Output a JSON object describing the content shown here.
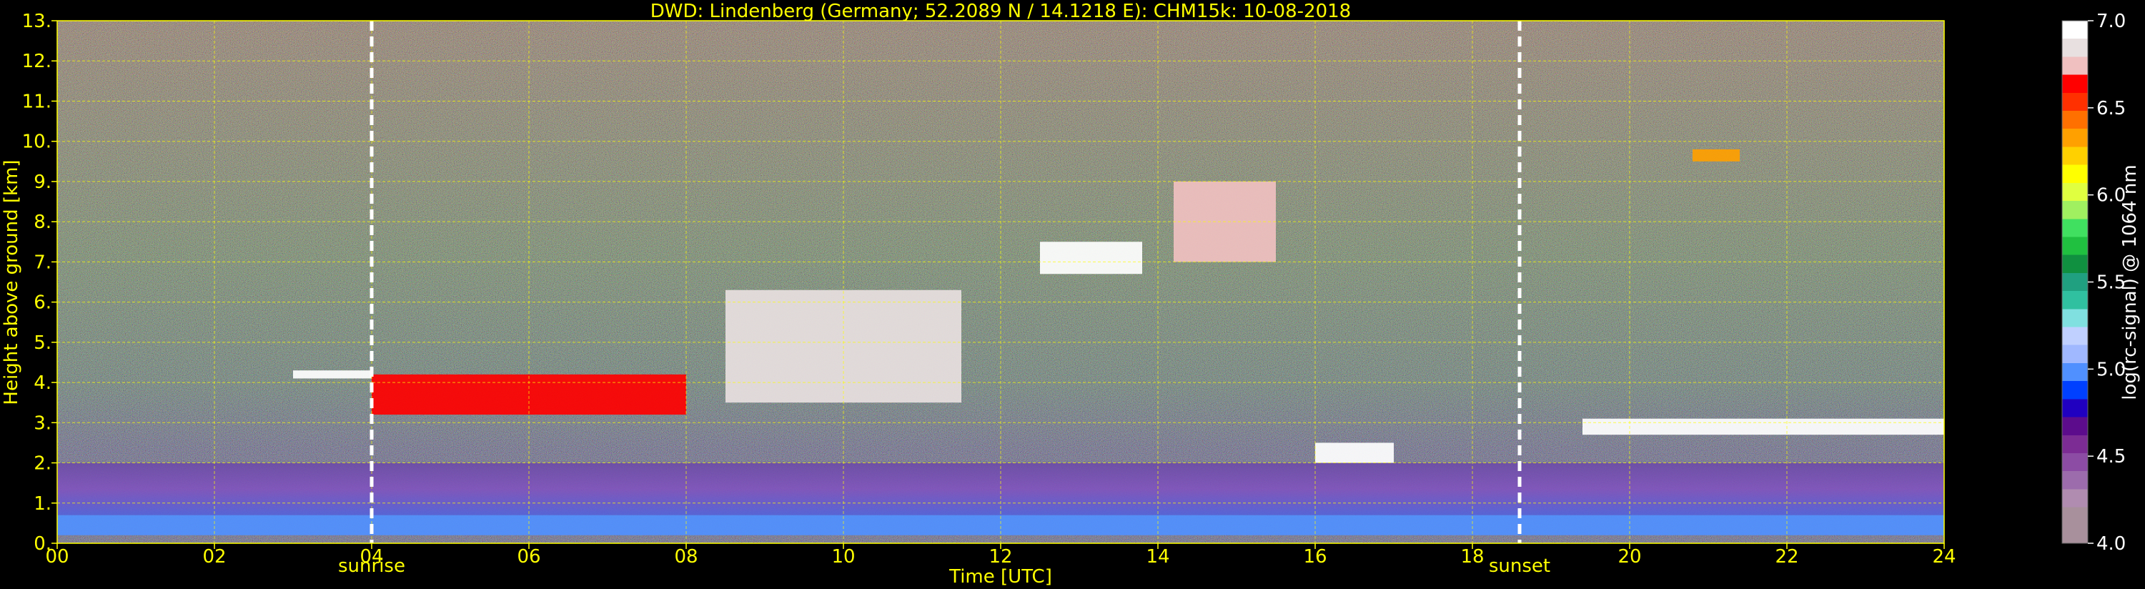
{
  "chart_data": {
    "type": "heatmap",
    "title": "DWD: Lindenberg (Germany; 52.2089 N / 14.1218 E):    CHM15k: 10-08-2018",
    "xlabel": "Time [UTC]",
    "ylabel": "Height above ground [km]",
    "xlim": [
      0,
      24
    ],
    "ylim": [
      0,
      13
    ],
    "x_ticks": [
      "00",
      "02",
      "04",
      "06",
      "08",
      "10",
      "12",
      "14",
      "16",
      "18",
      "20",
      "22",
      "24"
    ],
    "x_tick_values": [
      0,
      2,
      4,
      6,
      8,
      10,
      12,
      14,
      16,
      18,
      20,
      22,
      24
    ],
    "y_ticks": [
      "0.",
      "1.",
      "2.",
      "3.",
      "4.",
      "5.",
      "6.",
      "7.",
      "8.",
      "9.",
      "10.",
      "11.",
      "12.",
      "13."
    ],
    "y_tick_values": [
      0,
      1,
      2,
      3,
      4,
      5,
      6,
      7,
      8,
      9,
      10,
      11,
      12,
      13
    ],
    "grid": true,
    "markers": [
      {
        "label": "sunrise",
        "time": 4.0
      },
      {
        "label": "sunset",
        "time": 18.6
      }
    ],
    "colorbar": {
      "label": "log(rc-signal) @ 1064 nm",
      "range": [
        4.0,
        7.0
      ],
      "ticks": [
        "4.0",
        "4.5",
        "5.0",
        "5.5",
        "6.0",
        "6.5",
        "7.0"
      ],
      "tick_values": [
        4.0,
        4.5,
        5.0,
        5.5,
        6.0,
        6.5,
        7.0
      ],
      "colors": [
        "#a8909c",
        "#a8909c",
        "#b08cb0",
        "#9c6cac",
        "#8c4ca4",
        "#7c2c94",
        "#5c0c8c",
        "#2000c0",
        "#0040ff",
        "#5090ff",
        "#a0b8ff",
        "#c0d0ff",
        "#80e0e0",
        "#30c0a0",
        "#20a080",
        "#109040",
        "#20c040",
        "#40e060",
        "#a0f060",
        "#e0ff40",
        "#ffff00",
        "#ffd000",
        "#ffa000",
        "#ff7000",
        "#ff3000",
        "#ff0000",
        "#f0c0c0",
        "#e8e0e0",
        "#ffffff"
      ]
    },
    "layers": [
      {
        "feature": "near-surface aerosol",
        "from": 0,
        "to": 24,
        "base_km": 0.2,
        "top_km": 0.7,
        "log_signal": 5.0
      },
      {
        "feature": "boundary layer",
        "from": 0,
        "to": 24,
        "base_km": 0.7,
        "top_km": 2.0,
        "log_signal": 5.2
      },
      {
        "feature": "cloud layer",
        "from": 3.0,
        "to": 4.0,
        "base_km": 4.1,
        "top_km": 4.3,
        "log_signal": 7.0
      },
      {
        "feature": "cloud layer",
        "from": 4.0,
        "to": 8.0,
        "base_km": 3.2,
        "top_km": 4.2,
        "log_signal": 6.6
      },
      {
        "feature": "cloud layer",
        "from": 8.5,
        "to": 11.5,
        "base_km": 3.5,
        "top_km": 6.3,
        "log_signal": 6.8
      },
      {
        "feature": "cloud layer",
        "from": 12.5,
        "to": 13.8,
        "base_km": 6.7,
        "top_km": 7.5,
        "log_signal": 7.0
      },
      {
        "feature": "cloud layer",
        "from": 14.2,
        "to": 15.5,
        "base_km": 7.0,
        "top_km": 9.0,
        "log_signal": 6.7
      },
      {
        "feature": "cloud layer",
        "from": 16.0,
        "to": 17.0,
        "base_km": 2.0,
        "top_km": 2.5,
        "log_signal": 6.9
      },
      {
        "feature": "cloud layer",
        "from": 19.4,
        "to": 24.0,
        "base_km": 2.7,
        "top_km": 3.1,
        "log_signal": 7.0
      },
      {
        "feature": "cloud layer",
        "from": 20.8,
        "to": 21.4,
        "base_km": 9.5,
        "top_km": 9.8,
        "log_signal": 6.3
      }
    ]
  }
}
